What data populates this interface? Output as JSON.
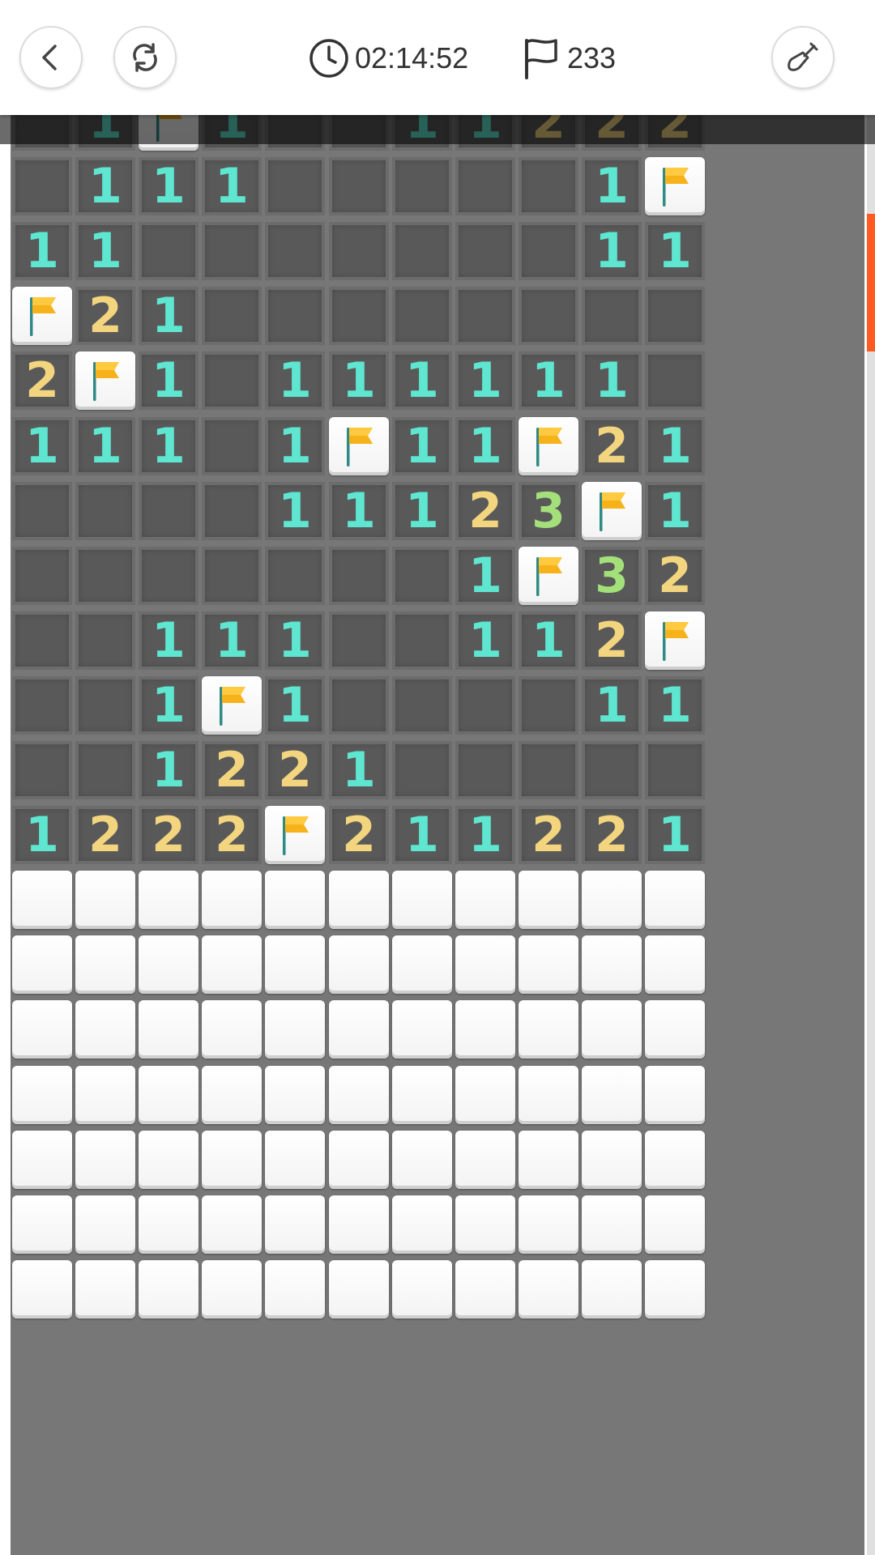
{
  "header": {
    "timer": "02:14:52",
    "flag_count": "233",
    "icons": [
      "chevron-left-icon",
      "refresh-icon",
      "clock-icon",
      "flag-outline-icon",
      "shovel-icon"
    ]
  },
  "colors": {
    "num1": "#5ee6d0",
    "num2": "#f2d57e",
    "num3": "#a4e07a",
    "revealed": "#595959",
    "hidden": "#ffffff",
    "flag": "#f6b21a",
    "scroll": "#ff5a1f"
  },
  "board": {
    "columns": 11,
    "legend": "0=empty revealed, 1-3=number, F=flag, H=unrevealed",
    "rows": [
      [
        "0",
        "1",
        "F",
        "1",
        "0",
        "0",
        "1",
        "1",
        "2",
        "2",
        "2"
      ],
      [
        "0",
        "1",
        "1",
        "1",
        "0",
        "0",
        "0",
        "0",
        "0",
        "1",
        "F"
      ],
      [
        "1",
        "1",
        "0",
        "0",
        "0",
        "0",
        "0",
        "0",
        "0",
        "1",
        "1"
      ],
      [
        "F",
        "2",
        "1",
        "0",
        "0",
        "0",
        "0",
        "0",
        "0",
        "0",
        "0"
      ],
      [
        "2",
        "F",
        "1",
        "0",
        "1",
        "1",
        "1",
        "1",
        "1",
        "1",
        "0"
      ],
      [
        "1",
        "1",
        "1",
        "0",
        "1",
        "F",
        "1",
        "1",
        "F",
        "2",
        "1"
      ],
      [
        "0",
        "0",
        "0",
        "0",
        "1",
        "1",
        "1",
        "2",
        "3",
        "F",
        "1"
      ],
      [
        "0",
        "0",
        "0",
        "0",
        "0",
        "0",
        "0",
        "1",
        "F",
        "3",
        "2"
      ],
      [
        "0",
        "0",
        "1",
        "1",
        "1",
        "0",
        "0",
        "1",
        "1",
        "2",
        "F"
      ],
      [
        "0",
        "0",
        "1",
        "F",
        "1",
        "0",
        "0",
        "0",
        "0",
        "1",
        "1"
      ],
      [
        "0",
        "0",
        "1",
        "2",
        "2",
        "1",
        "0",
        "0",
        "0",
        "0",
        "0"
      ],
      [
        "1",
        "2",
        "2",
        "2",
        "F",
        "2",
        "1",
        "1",
        "2",
        "2",
        "1"
      ],
      [
        "H",
        "H",
        "H",
        "H",
        "H",
        "H",
        "H",
        "H",
        "H",
        "H",
        "H"
      ],
      [
        "H",
        "H",
        "H",
        "H",
        "H",
        "H",
        "H",
        "H",
        "H",
        "H",
        "H"
      ],
      [
        "H",
        "H",
        "H",
        "H",
        "H",
        "H",
        "H",
        "H",
        "H",
        "H",
        "H"
      ],
      [
        "H",
        "H",
        "H",
        "H",
        "H",
        "H",
        "H",
        "H",
        "H",
        "H",
        "H"
      ],
      [
        "H",
        "H",
        "H",
        "H",
        "H",
        "H",
        "H",
        "H",
        "H",
        "H",
        "H"
      ],
      [
        "H",
        "H",
        "H",
        "H",
        "H",
        "H",
        "H",
        "H",
        "H",
        "H",
        "H"
      ],
      [
        "H",
        "H",
        "H",
        "H",
        "H",
        "H",
        "H",
        "H",
        "H",
        "H",
        "H"
      ]
    ]
  }
}
